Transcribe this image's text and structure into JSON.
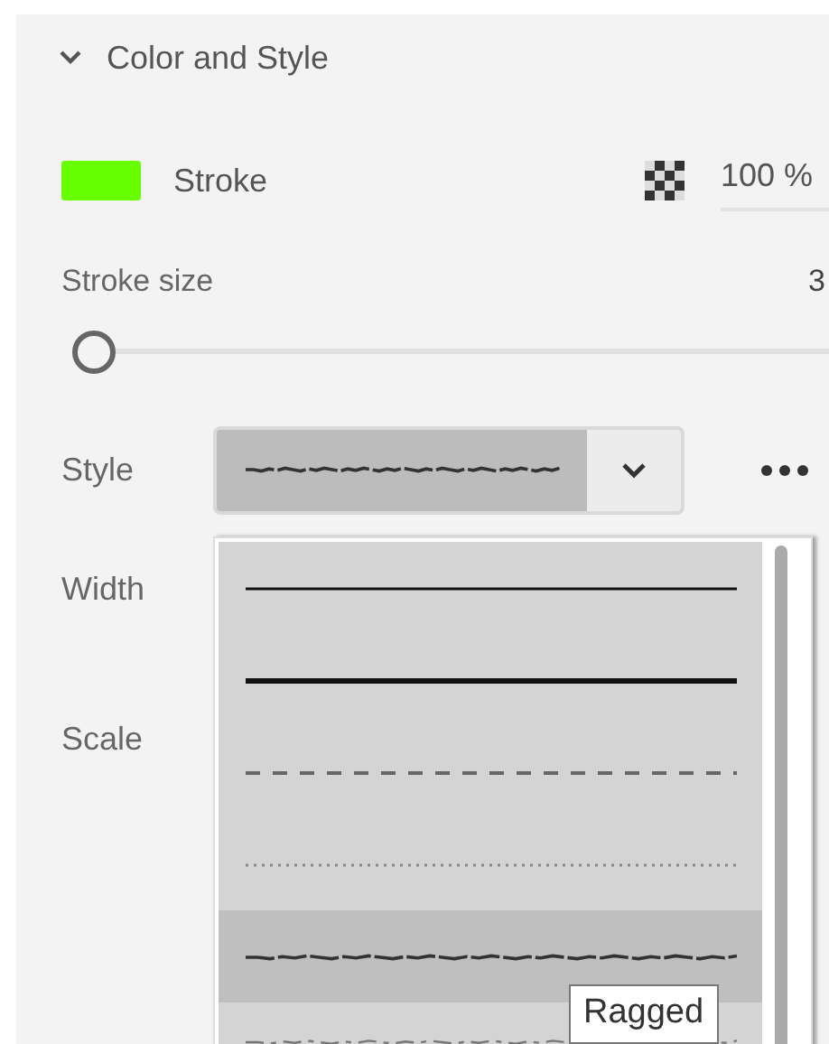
{
  "section": {
    "title": "Color and Style",
    "expanded": true
  },
  "stroke": {
    "label": "Stroke",
    "color": "#66ff00",
    "opacity": "100 %"
  },
  "stroke_size": {
    "label": "Stroke size",
    "value": "3",
    "level": 0
  },
  "style": {
    "label": "Style",
    "options": [
      {
        "kind": "solid",
        "selected": false
      },
      {
        "kind": "thick",
        "selected": false
      },
      {
        "kind": "dashed",
        "selected": false
      },
      {
        "kind": "dotted",
        "selected": false
      },
      {
        "kind": "ragged",
        "selected": true
      },
      {
        "kind": "sketch",
        "selected": false
      }
    ],
    "tooltip": "Ragged"
  },
  "width": {
    "label": "Width"
  },
  "scale": {
    "label": "Scale"
  }
}
